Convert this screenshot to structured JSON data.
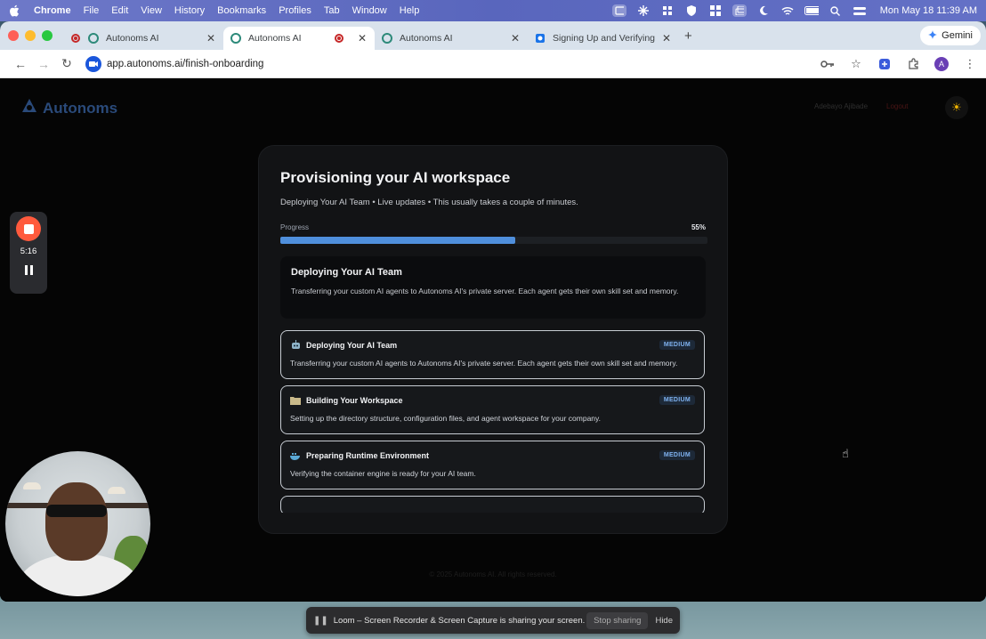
{
  "menubar": {
    "app_name": "Chrome",
    "items": [
      "File",
      "Edit",
      "View",
      "History",
      "Bookmarks",
      "Profiles",
      "Tab",
      "Window",
      "Help"
    ],
    "clock": "Mon May 18  11:39 AM"
  },
  "tabs": [
    {
      "title": "Autonoms AI"
    },
    {
      "title": "Autonoms AI"
    },
    {
      "title": "Autonoms AI"
    },
    {
      "title": "Signing Up and Verifying You…"
    }
  ],
  "gemini_label": "Gemini",
  "url": "app.autonoms.ai/finish-onboarding",
  "avatar_letter": "A",
  "header": {
    "brand": "Autonoms",
    "user_name": "Adebayo Ajibade",
    "logout": "Logout"
  },
  "card": {
    "title": "Provisioning your AI workspace",
    "subtitle": "Deploying Your AI Team • Live updates • This usually takes a couple of minutes.",
    "progress_label": "Progress",
    "progress_value": 55,
    "progress_text": "55%",
    "current_step": {
      "title": "Deploying Your AI Team",
      "description": "Transferring your custom AI agents to Autonoms AI's private server. Each agent gets their own skill set and memory."
    },
    "steps": [
      {
        "icon": "robot-icon",
        "title": "Deploying Your AI Team",
        "badge": "MEDIUM",
        "description": "Transferring your custom AI agents to Autonoms AI's private server. Each agent gets their own skill set and memory."
      },
      {
        "icon": "folder-icon",
        "title": "Building Your Workspace",
        "badge": "MEDIUM",
        "description": "Setting up the directory structure, configuration files, and agent workspace for your company."
      },
      {
        "icon": "whale-icon",
        "title": "Preparing Runtime Environment",
        "badge": "MEDIUM",
        "description": "Verifying the container engine is ready for your AI team."
      }
    ]
  },
  "footer": "© 2025 Autonoms AI. All rights reserved.",
  "loom": {
    "timer": "5:16",
    "share_text": "Loom – Screen Recorder & Screen Capture is sharing your screen.",
    "stop_sharing": "Stop sharing",
    "hide": "Hide"
  },
  "colors": {
    "accent": "#4f8fdc",
    "badge_text": "#7fb2f0",
    "loom_red": "#ff5a3d"
  }
}
